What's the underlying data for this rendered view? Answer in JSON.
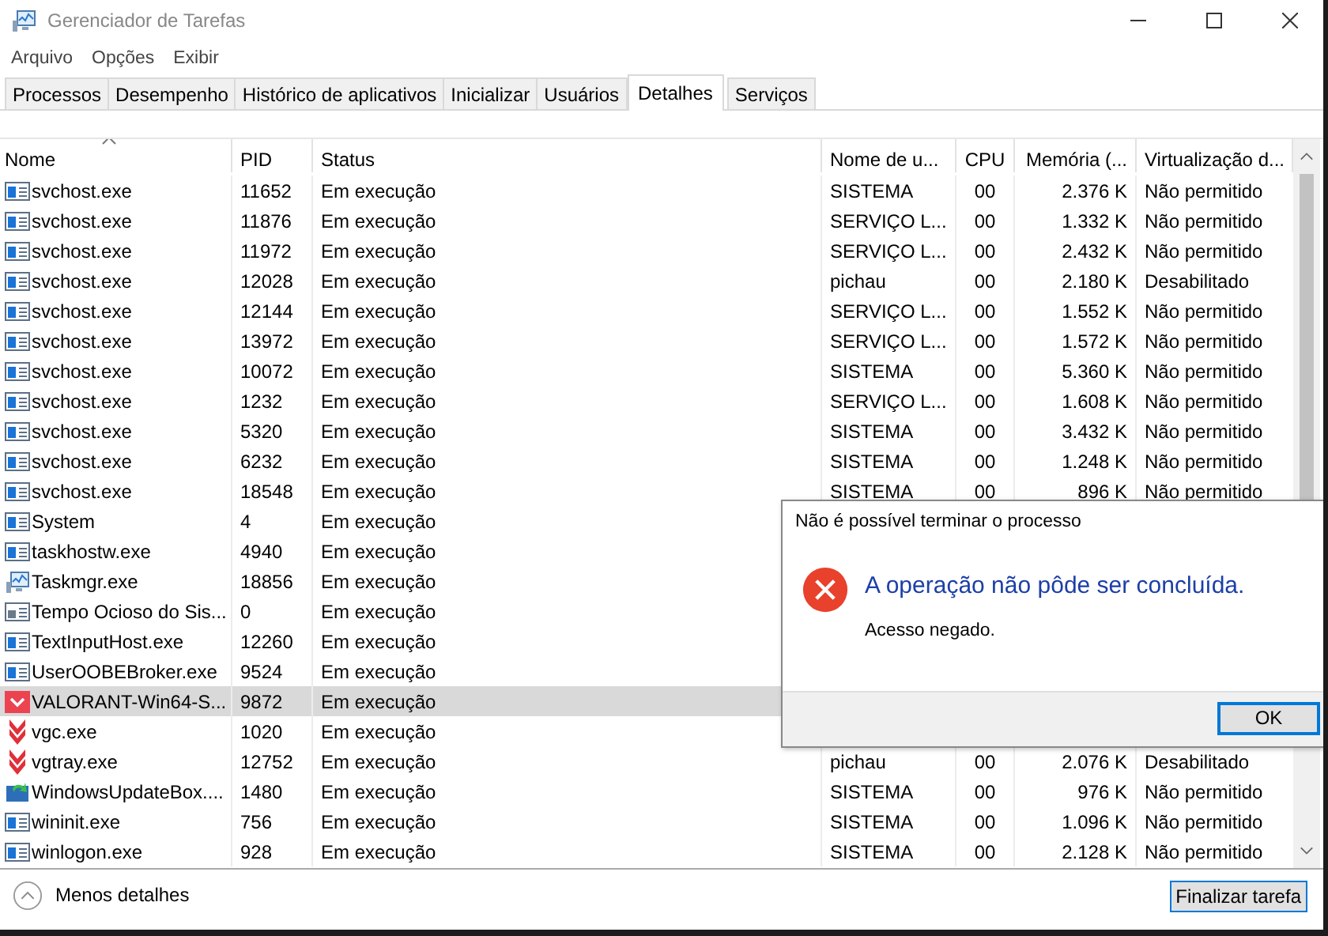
{
  "window": {
    "title": "Gerenciador de Tarefas"
  },
  "menu": [
    "Arquivo",
    "Opções",
    "Exibir"
  ],
  "tabs": [
    {
      "label": "Processos",
      "selected": false
    },
    {
      "label": "Desempenho",
      "selected": false
    },
    {
      "label": "Histórico de aplicativos",
      "selected": false
    },
    {
      "label": "Inicializar",
      "selected": false
    },
    {
      "label": "Usuários",
      "selected": false
    },
    {
      "label": "Detalhes",
      "selected": true
    },
    {
      "label": "Serviços",
      "selected": false
    }
  ],
  "table": {
    "columns": [
      "Nome",
      "PID",
      "Status",
      "Nome de u...",
      "CPU",
      "Memória (...",
      "Virtualização d..."
    ],
    "rows": [
      {
        "kind": "service",
        "name": "svchost.exe",
        "pid": "11652",
        "status": "Em execução",
        "user": "SISTEMA",
        "cpu": "00",
        "memory": "2.376 K",
        "virtualization": "Não permitido",
        "selected": false
      },
      {
        "kind": "service",
        "name": "svchost.exe",
        "pid": "11876",
        "status": "Em execução",
        "user": "SERVIÇO L...",
        "cpu": "00",
        "memory": "1.332 K",
        "virtualization": "Não permitido",
        "selected": false
      },
      {
        "kind": "service",
        "name": "svchost.exe",
        "pid": "11972",
        "status": "Em execução",
        "user": "SERVIÇO L...",
        "cpu": "00",
        "memory": "2.432 K",
        "virtualization": "Não permitido",
        "selected": false
      },
      {
        "kind": "service",
        "name": "svchost.exe",
        "pid": "12028",
        "status": "Em execução",
        "user": "pichau",
        "cpu": "00",
        "memory": "2.180 K",
        "virtualization": "Desabilitado",
        "selected": false
      },
      {
        "kind": "service",
        "name": "svchost.exe",
        "pid": "12144",
        "status": "Em execução",
        "user": "SERVIÇO L...",
        "cpu": "00",
        "memory": "1.552 K",
        "virtualization": "Não permitido",
        "selected": false
      },
      {
        "kind": "service",
        "name": "svchost.exe",
        "pid": "13972",
        "status": "Em execução",
        "user": "SERVIÇO L...",
        "cpu": "00",
        "memory": "1.572 K",
        "virtualization": "Não permitido",
        "selected": false
      },
      {
        "kind": "service",
        "name": "svchost.exe",
        "pid": "10072",
        "status": "Em execução",
        "user": "SISTEMA",
        "cpu": "00",
        "memory": "5.360 K",
        "virtualization": "Não permitido",
        "selected": false
      },
      {
        "kind": "service",
        "name": "svchost.exe",
        "pid": "1232",
        "status": "Em execução",
        "user": "SERVIÇO L...",
        "cpu": "00",
        "memory": "1.608 K",
        "virtualization": "Não permitido",
        "selected": false
      },
      {
        "kind": "service",
        "name": "svchost.exe",
        "pid": "5320",
        "status": "Em execução",
        "user": "SISTEMA",
        "cpu": "00",
        "memory": "3.432 K",
        "virtualization": "Não permitido",
        "selected": false
      },
      {
        "kind": "service",
        "name": "svchost.exe",
        "pid": "6232",
        "status": "Em execução",
        "user": "SISTEMA",
        "cpu": "00",
        "memory": "1.248 K",
        "virtualization": "Não permitido",
        "selected": false
      },
      {
        "kind": "service",
        "name": "svchost.exe",
        "pid": "18548",
        "status": "Em execução",
        "user": "SISTEMA",
        "cpu": "00",
        "memory": "896 K",
        "virtualization": "Não permitido",
        "selected": false
      },
      {
        "kind": "service",
        "name": "System",
        "pid": "4",
        "status": "Em execução",
        "selected": false
      },
      {
        "kind": "service",
        "name": "taskhostw.exe",
        "pid": "4940",
        "status": "Em execução",
        "selected": false
      },
      {
        "kind": "monitor",
        "name": "Taskmgr.exe",
        "pid": "18856",
        "status": "Em execução",
        "selected": false
      },
      {
        "kind": "idle",
        "name": "Tempo Ocioso do Sis...",
        "pid": "0",
        "status": "Em execução",
        "selected": false
      },
      {
        "kind": "service",
        "name": "TextInputHost.exe",
        "pid": "12260",
        "status": "Em execução",
        "selected": false
      },
      {
        "kind": "service",
        "name": "UserOOBEBroker.exe",
        "pid": "9524",
        "status": "Em execução",
        "selected": false
      },
      {
        "kind": "redtile",
        "name": "VALORANT-Win64-S...",
        "pid": "9872",
        "status": "Em execução",
        "selected": true
      },
      {
        "kind": "redshield",
        "name": "vgc.exe",
        "pid": "1020",
        "status": "Em execução",
        "selected": false
      },
      {
        "kind": "redshield",
        "name": "vgtray.exe",
        "pid": "12752",
        "status": "Em execução",
        "user": "pichau",
        "cpu": "00",
        "memory": "2.076 K",
        "virtualization": "Desabilitado",
        "selected": false
      },
      {
        "kind": "update",
        "name": "WindowsUpdateBox....",
        "pid": "1480",
        "status": "Em execução",
        "user": "SISTEMA",
        "cpu": "00",
        "memory": "976 K",
        "virtualization": "Não permitido",
        "selected": false
      },
      {
        "kind": "service",
        "name": "wininit.exe",
        "pid": "756",
        "status": "Em execução",
        "user": "SISTEMA",
        "cpu": "00",
        "memory": "1.096 K",
        "virtualization": "Não permitido",
        "selected": false
      },
      {
        "kind": "service",
        "name": "winlogon.exe",
        "pid": "928",
        "status": "Em execução",
        "user": "SISTEMA",
        "cpu": "00",
        "memory": "2.128 K",
        "virtualization": "Não permitido",
        "selected": false
      }
    ]
  },
  "footer": {
    "less_details": "Menos detalhes",
    "end_task": "Finalizar tarefa"
  },
  "dialog": {
    "title": "Não é possível terminar o processo",
    "heading": "A operação não pôde ser concluída.",
    "message": "Acesso negado.",
    "ok": "OK"
  }
}
